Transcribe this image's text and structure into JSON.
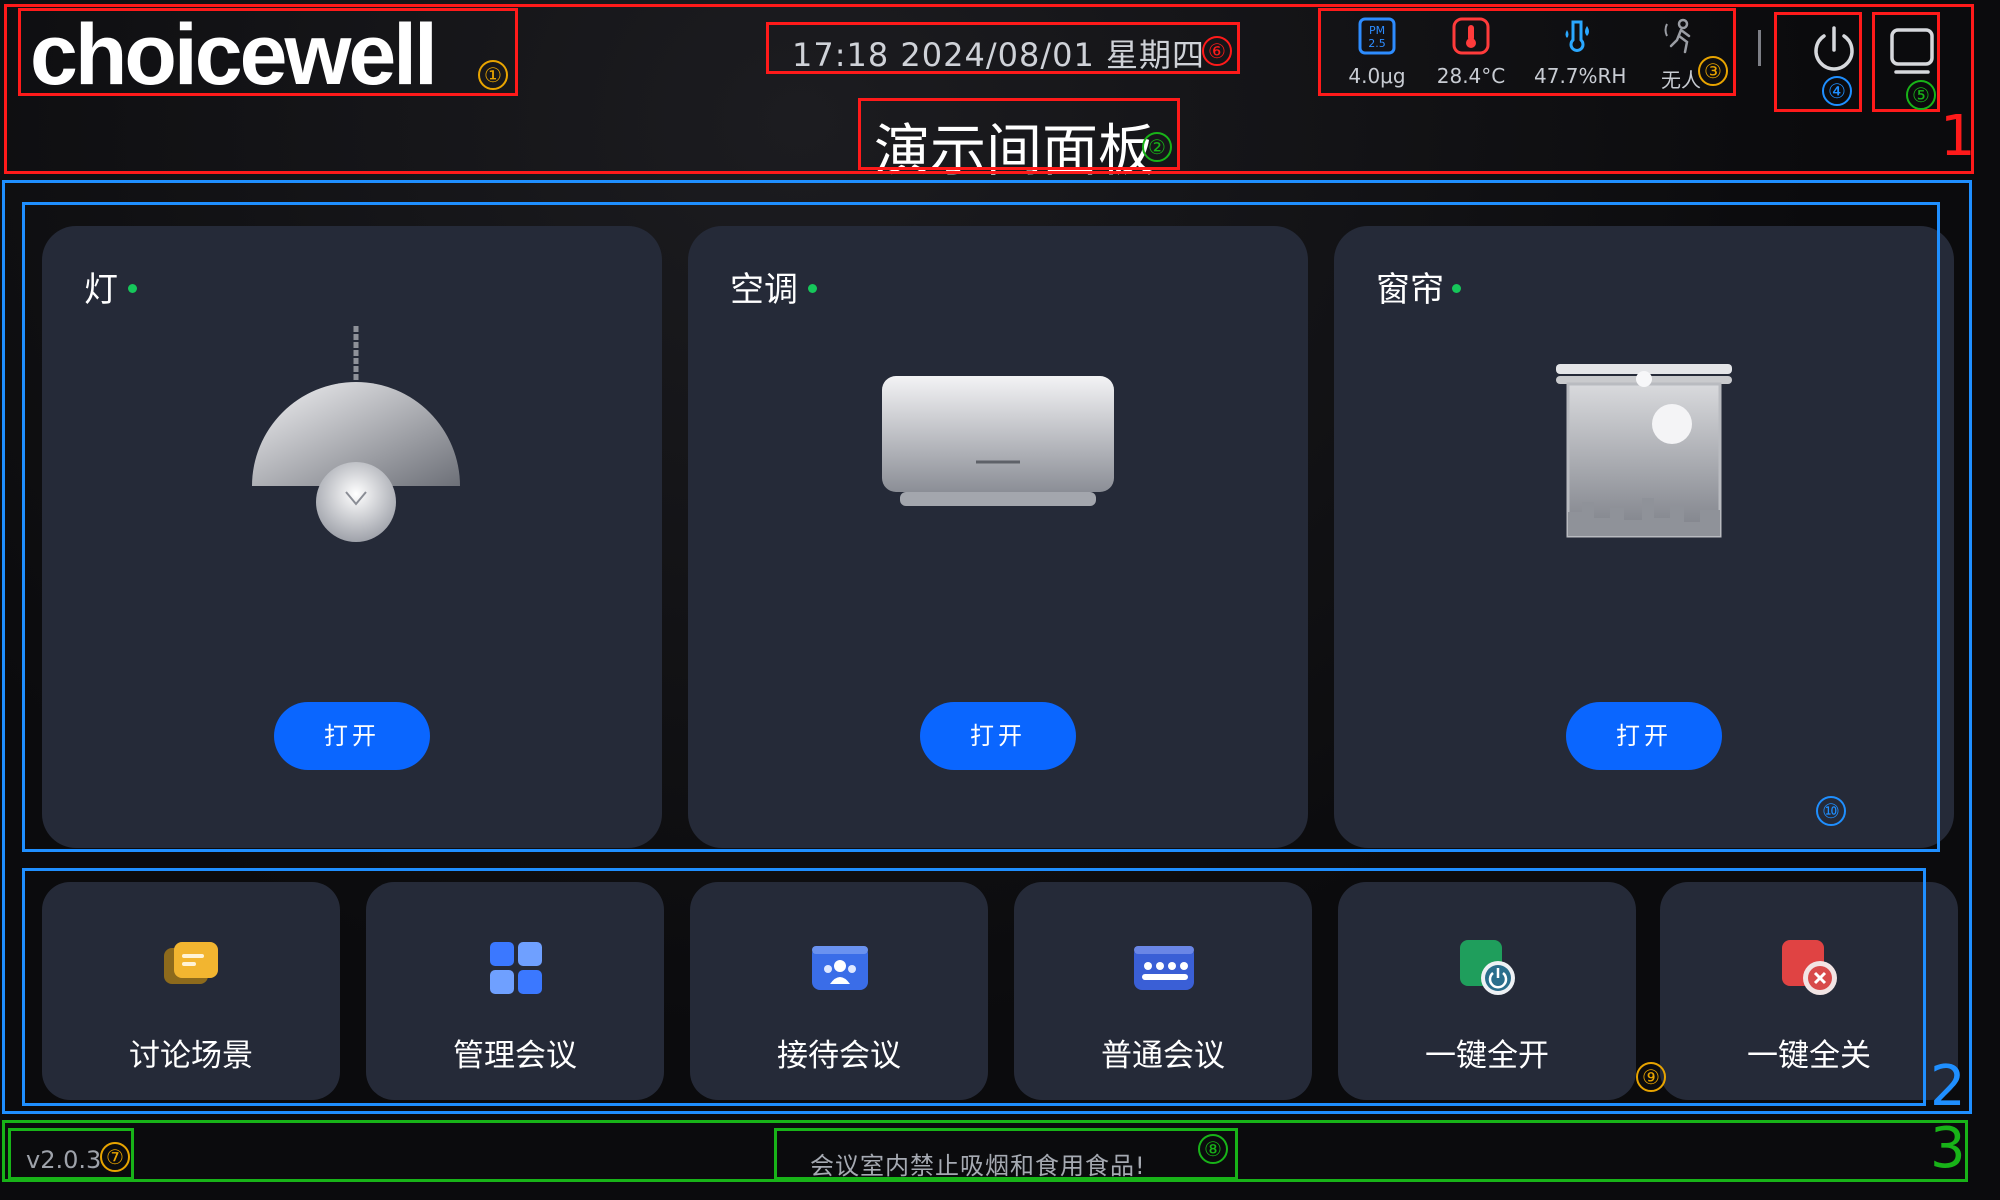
{
  "header": {
    "logo_text": "choicewell",
    "datetime": "17:18 2024/08/01 星期四",
    "room_title": "演示间面板",
    "sensors": [
      {
        "icon": "pm25-icon",
        "value": "4.0μg",
        "badge": "PM 2.5"
      },
      {
        "icon": "thermometer-icon",
        "value": "28.4°C"
      },
      {
        "icon": "humidity-icon",
        "value": "47.7%RH"
      },
      {
        "icon": "occupancy-icon",
        "value": "无人"
      }
    ],
    "power_icon": "power-icon",
    "screen_icon": "screen-icon"
  },
  "devices": [
    {
      "name": "灯",
      "button": "打开",
      "icon": "pendant-lamp-icon"
    },
    {
      "name": "空调",
      "button": "打开",
      "icon": "air-conditioner-icon"
    },
    {
      "name": "窗帘",
      "button": "打开",
      "icon": "curtain-icon"
    }
  ],
  "scenes": [
    {
      "label": "讨论场景",
      "icon": "chat-icon"
    },
    {
      "label": "管理会议",
      "icon": "grid-icon"
    },
    {
      "label": "接待会议",
      "icon": "group-icon"
    },
    {
      "label": "普通会议",
      "icon": "team-icon"
    },
    {
      "label": "一键全开",
      "icon": "all-on-icon"
    },
    {
      "label": "一键全关",
      "icon": "all-off-icon"
    }
  ],
  "footer": {
    "version": "v2.0.3",
    "notice": "会议室内禁止吸烟和食用食品!"
  },
  "annotations": {
    "markers": [
      "①",
      "②",
      "③",
      "④",
      "⑤",
      "⑥",
      "⑦",
      "⑧",
      "⑨",
      "⑩"
    ],
    "sections": [
      "1",
      "2",
      "3"
    ]
  },
  "colors": {
    "background": "#0b0b0d",
    "card": "#252a38",
    "button": "#0a66ff",
    "status_dot": "#16c75a",
    "annotation_red": "#ff1a1a",
    "annotation_blue": "#1f8fff",
    "annotation_green": "#18b318",
    "annotation_orange": "#e8a400"
  }
}
